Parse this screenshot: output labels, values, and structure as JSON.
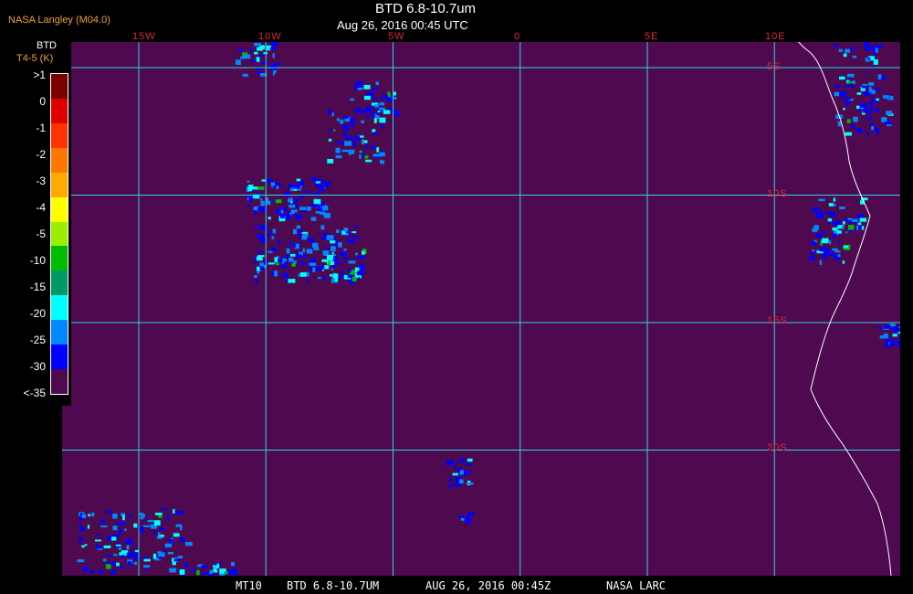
{
  "header": {
    "credit": "NASA Langley (M04.0)",
    "title": "BTD 6.8-10.7um",
    "subtitle": "Aug 26, 2016 00:45 UTC"
  },
  "legend": {
    "title": "BTD",
    "units": "T4-5 (K)",
    "levels": [
      ">1",
      "0",
      "-1",
      "-2",
      "-3",
      "-4",
      "-5",
      "-10",
      "-15",
      "-20",
      "-25",
      "-30",
      "<-35"
    ],
    "colors": [
      "#7a0000",
      "#e00000",
      "#ff3300",
      "#ff7700",
      "#ffaa00",
      "#ffff00",
      "#9aee00",
      "#00bb00",
      "#009966",
      "#00ffff",
      "#0088ff",
      "#0000ff",
      "#4f0a4f"
    ]
  },
  "map": {
    "background": "#4f0a4f",
    "grid_color": "#2ad4e8",
    "coast_color": "#ffffff",
    "label_color": "#e0283a",
    "lon_labels": [
      "15W",
      "10W",
      "5W",
      "0",
      "5E",
      "10E"
    ],
    "lat_labels": [
      "5S",
      "10S",
      "15S",
      "20S"
    ],
    "lon_values": [
      -15,
      -10,
      -5,
      0,
      5,
      10
    ],
    "lat_values": [
      -5,
      -10,
      -15,
      -20
    ]
  },
  "footer": {
    "sat": "MT10",
    "product": "BTD 6.8-10.7UM",
    "datetime": "AUG 26, 2016 00:45Z",
    "org": "NASA LARC"
  }
}
